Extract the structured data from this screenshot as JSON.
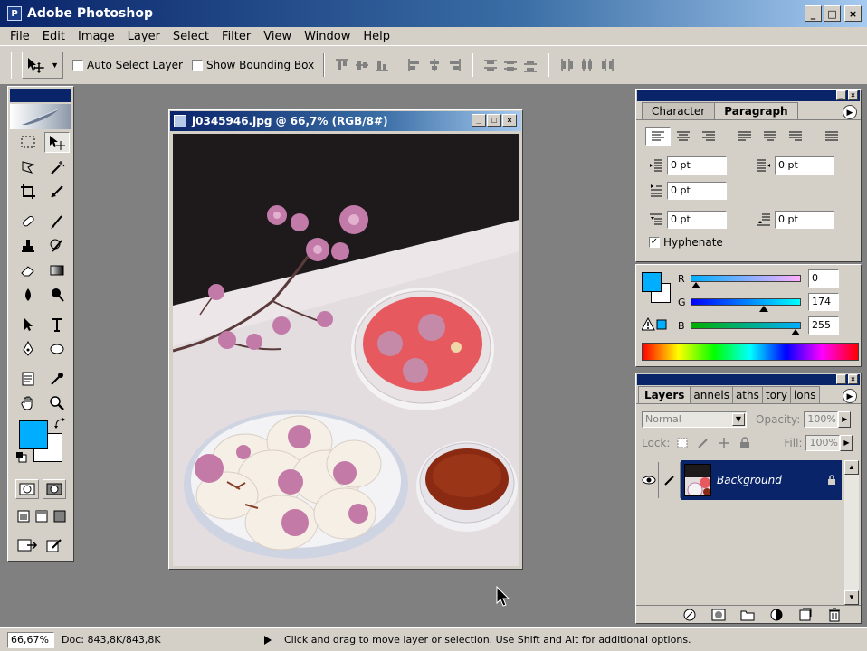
{
  "app": {
    "title": "Adobe Photoshop",
    "icon_text": "P"
  },
  "window_controls": {
    "minimize": "_",
    "maximize": "□",
    "close": "×"
  },
  "menu": [
    "File",
    "Edit",
    "Image",
    "Layer",
    "Select",
    "Filter",
    "View",
    "Window",
    "Help"
  ],
  "options": {
    "auto_select_layer": {
      "label": "Auto Select Layer",
      "checked": false
    },
    "show_bounding_box": {
      "label": "Show Bounding Box",
      "checked": false
    }
  },
  "document": {
    "title": "j0345946.jpg @ 66,7% (RGB/8#)",
    "zoom": "66,67%",
    "doc_size": "Doc: 843,8K/843,8K"
  },
  "paragraph_panel": {
    "tabs": [
      "Character",
      "Paragraph"
    ],
    "active_tab": "Paragraph",
    "fields": {
      "indent_left": "0 pt",
      "indent_right": "0 pt",
      "indent_first": "0 pt",
      "space_before": "0 pt",
      "space_after": "0 pt"
    },
    "hyphenate": {
      "label": "Hyphenate",
      "checked": true
    }
  },
  "color_panel": {
    "foreground": "#00aeff",
    "background": "#ffffff",
    "channels": [
      {
        "label": "R",
        "value": "0",
        "level": 0.0
      },
      {
        "label": "G",
        "value": "174",
        "level": 0.68
      },
      {
        "label": "B",
        "value": "255",
        "level": 1.0
      }
    ]
  },
  "layers_panel": {
    "tabs": [
      "Layers",
      "annels",
      "aths",
      "tory",
      "ions"
    ],
    "active_tab": "Layers",
    "blend_mode": "Normal",
    "opacity_label": "Opacity:",
    "opacity": "100%",
    "lock_label": "Lock:",
    "fill_label": "Fill:",
    "fill": "100%",
    "layers": [
      {
        "name": "Background",
        "visible": true,
        "locked": true
      }
    ]
  },
  "status": {
    "message": "Click and drag to move layer or selection.  Use Shift and Alt for additional options."
  }
}
